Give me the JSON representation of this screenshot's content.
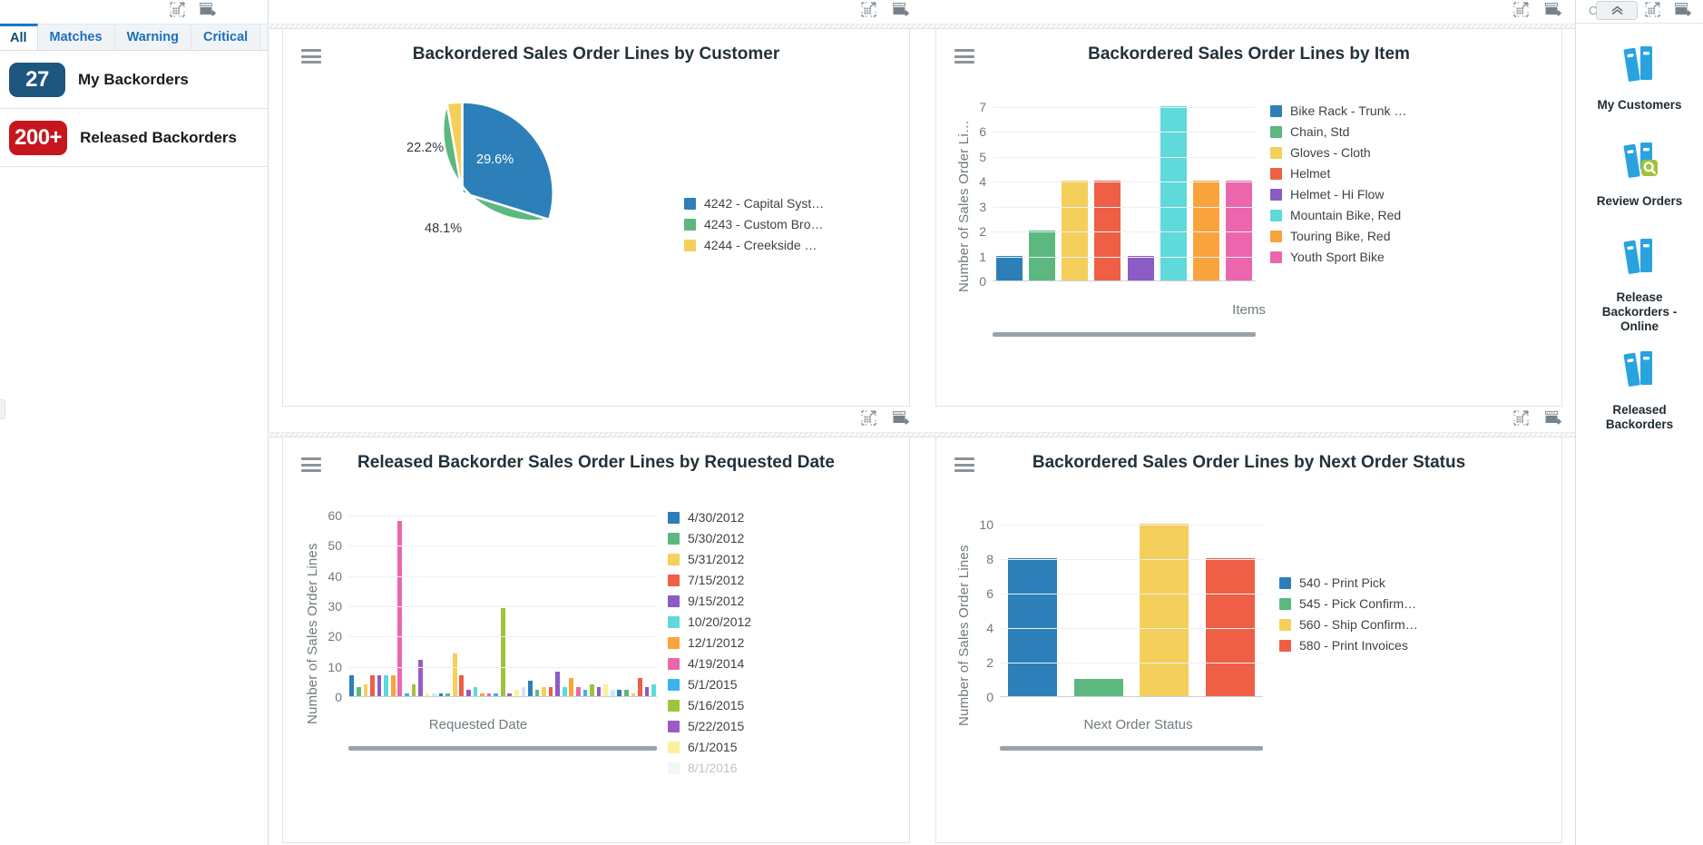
{
  "left_panel": {
    "tabs": [
      {
        "label": "All",
        "active": true
      },
      {
        "label": "Matches",
        "active": false
      },
      {
        "label": "Warning",
        "active": false
      },
      {
        "label": "Critical",
        "active": false
      }
    ],
    "kpis": [
      {
        "count": "27",
        "label": "My Backorders",
        "color": "#1d567f"
      },
      {
        "count": "200+",
        "label": "Released Backorders",
        "color": "#c7161d"
      }
    ],
    "toolbar_icons": [
      "expand-grid-icon",
      "export-icon"
    ]
  },
  "right_panel": {
    "collapse_label": "Cust...",
    "toolbar_icons": [
      "expand-grid-icon",
      "export-icon"
    ],
    "nav_items": [
      {
        "label": "My Customers",
        "icon": "books-icon"
      },
      {
        "label": "Review Orders",
        "icon": "books-search-icon"
      },
      {
        "label": "Release Backorders - Online",
        "icon": "books-icon"
      },
      {
        "label": "Released Backorders",
        "icon": "books-icon"
      }
    ]
  },
  "panels": [
    {
      "title": "Backordered Sales Order Lines by Customer",
      "menu_icon": "hamburger-menu-icon",
      "toolbar_icons": [
        "expand-grid-icon",
        "export-icon"
      ]
    },
    {
      "title": "Backordered Sales Order Lines by Item",
      "menu_icon": "hamburger-menu-icon",
      "toolbar_icons": [
        "expand-grid-icon",
        "export-icon"
      ]
    },
    {
      "title": "Released Backorder Sales Order Lines by Requested Date",
      "menu_icon": "hamburger-menu-icon",
      "toolbar_icons": [
        "expand-grid-icon",
        "export-icon"
      ]
    },
    {
      "title": "Backordered Sales Order Lines by Next Order Status",
      "menu_icon": "hamburger-menu-icon",
      "toolbar_icons": [
        "expand-grid-icon",
        "export-icon"
      ]
    }
  ],
  "chart_data": [
    {
      "type": "pie",
      "title": "Backordered Sales Order Lines by Customer",
      "categories": [
        "4242 - Capital Syst…",
        "4243 - Custom Bro…",
        "4244 - Creekside …"
      ],
      "values": [
        29.6,
        48.1,
        22.2
      ],
      "value_labels": [
        "29.6%",
        "48.1%",
        "22.2%"
      ],
      "colors": [
        "#2c7fb8",
        "#5cb87f",
        "#f5cf5b"
      ],
      "legend_position": "right",
      "xlabel": "",
      "ylabel": ""
    },
    {
      "type": "bar",
      "title": "Backordered Sales Order Lines by Item",
      "categories": [
        "Bike Rack - Trunk …",
        "Chain, Std",
        "Gloves - Cloth",
        "Helmet",
        "Helmet - Hi Flow",
        "Mountain Bike, Red",
        "Touring Bike, Red",
        "Youth Sport Bike"
      ],
      "values": [
        1,
        2,
        4,
        4,
        1,
        7,
        4,
        4
      ],
      "colors": [
        "#2c7fb8",
        "#5cb87f",
        "#f5cf5b",
        "#ef5f45",
        "#8a5cc4",
        "#5fd9da",
        "#f9a33c",
        "#eb66ac"
      ],
      "xlabel": "Items",
      "ylabel": "Number of Sales Order Li…",
      "yticks": [
        0,
        1,
        2,
        3,
        4,
        5,
        6,
        7
      ],
      "ylim": [
        0,
        7
      ],
      "grid": true,
      "legend_position": "right"
    },
    {
      "type": "bar",
      "title": "Released Backorder Sales Order Lines by Requested Date",
      "categories": [
        "4/30/2012",
        "5/30/2012",
        "5/31/2012",
        "7/15/2012",
        "9/15/2012",
        "10/20/2012",
        "12/1/2012",
        "4/19/2014",
        "5/1/2015",
        "5/16/2015",
        "5/22/2015",
        "6/1/2015",
        "8/1/2016"
      ],
      "values": [
        7,
        3,
        4,
        7,
        7,
        7,
        7,
        58,
        1,
        4,
        12,
        1,
        1,
        1,
        1,
        14,
        7,
        2,
        3,
        1,
        1,
        1,
        29,
        1,
        2,
        3,
        5,
        2,
        3,
        3,
        8,
        3,
        6,
        3,
        2,
        4,
        3,
        4,
        2,
        2,
        2,
        1,
        6,
        3,
        4
      ],
      "colors": [
        "#2c7fb8",
        "#5cb87f",
        "#f5cf5b",
        "#ef5f45",
        "#8a5cc4",
        "#5fd9da",
        "#f9a33c",
        "#eb66ac",
        "#3bb3ef",
        "#9fc33a",
        "#9a5cc4",
        "#fbf19b",
        "#cfe7f5"
      ],
      "xlabel": "Requested Date",
      "ylabel": "Number of Sales Order Lines",
      "yticks": [
        0,
        10,
        20,
        30,
        40,
        50,
        60
      ],
      "ylim": [
        0,
        60
      ],
      "grid": true,
      "legend_position": "right"
    },
    {
      "type": "bar",
      "title": "Backordered Sales Order Lines by Next Order Status",
      "categories": [
        "540 - Print Pick",
        "545 - Pick Confirm…",
        "560 - Ship Confirm…",
        "580 - Print Invoices"
      ],
      "values": [
        8,
        1,
        10,
        8
      ],
      "colors": [
        "#2c7fb8",
        "#5cb87f",
        "#f5cf5b",
        "#ef5f45"
      ],
      "xlabel": "Next Order Status",
      "ylabel": "Number of Sales Order Lines",
      "yticks": [
        0,
        2,
        4,
        6,
        8,
        10
      ],
      "ylim": [
        0,
        10
      ],
      "grid": true,
      "legend_position": "right"
    }
  ],
  "theme": {
    "accent": "#1877c9",
    "badge_blue": "#1d567f",
    "badge_red": "#c7161d",
    "icon_blue": "#29a3e0",
    "icon_green": "#9fc33a",
    "text_dark": "#22313a",
    "axis_gray": "#707b81"
  }
}
